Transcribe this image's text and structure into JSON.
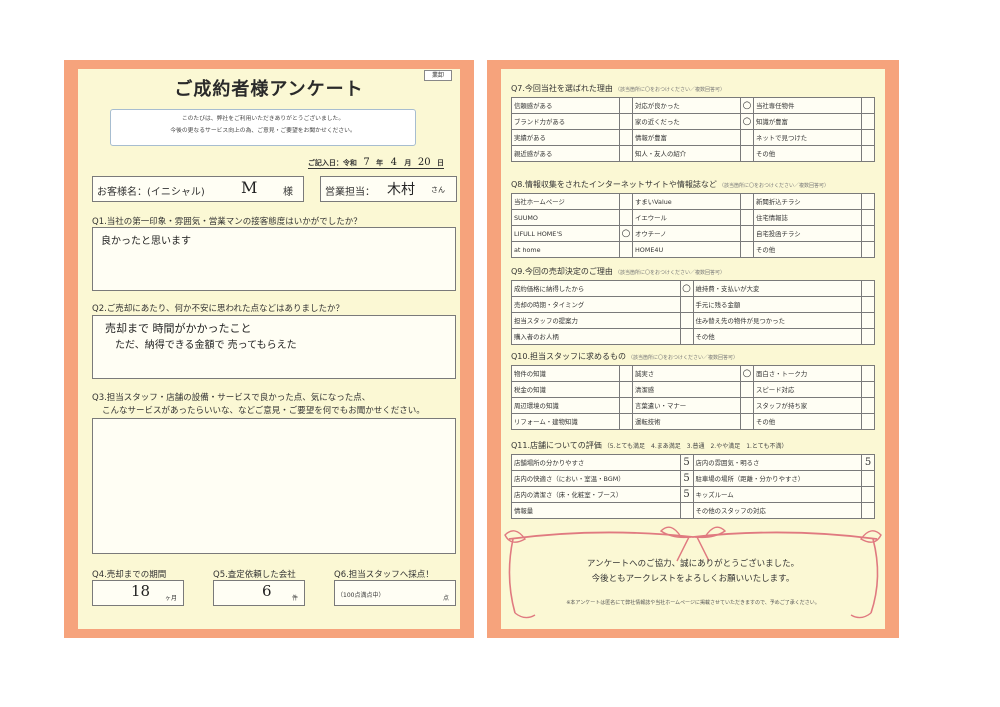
{
  "left": {
    "badge": "業卸",
    "title": "ご成約者様アンケート",
    "intro_line1": "このたびは、弊社をご利用いただきありがとうございました。",
    "intro_line2": "今後の更なるサービス向上の為、ご意見・ご要望をお聞かせください。",
    "date_label": "ご記入日：令和",
    "date_year": "7",
    "date_year_unit": "年",
    "date_month": "4",
    "date_month_unit": "月",
    "date_day": "20",
    "date_day_unit": "日",
    "customer_label": "お客様名：(イニシャル)",
    "customer_value": "M",
    "customer_suffix": "様",
    "staff_label": "営業担当：",
    "staff_value": "木村",
    "staff_suffix": "さん",
    "q1": "Q1.当社の第一印象・雰囲気・営業マンの接客態度はいかがでしたか？",
    "a1": "良かったと思います",
    "q2": "Q2.ご売却にあたり、何か不安に思われた点などはありましたか？",
    "a2_line1": "売却まで 時間がかかったこと",
    "a2_line2": "ただ、納得できる金額で 売ってもらえた",
    "q3_line1": "Q3.担当スタッフ・店舗の設備・サービスで良かった点、気になった点、",
    "q3_line2": "こんなサービスがあったらいいな、などご意見・ご要望を何でもお聞かせください。",
    "a3": "",
    "q4": "Q4.売却までの期間",
    "a4": "18",
    "a4_unit": "ヶ月",
    "q5": "Q5.査定依頼した会社",
    "a5": "6",
    "a5_unit": "件",
    "q6": "Q6.担当スタッフへ採点！",
    "a6_hint": "（100点満点中）",
    "a6_unit": "点"
  },
  "right": {
    "q7": {
      "title": "Q7.今回当社を選ばれた理由",
      "note": "（該当箇所に〇をおつけください／複数回答可）",
      "rows": [
        [
          {
            "label": "信頼感がある",
            "mark": ""
          },
          {
            "label": "対応が良かった",
            "mark": "○"
          },
          {
            "label": "当社専任物件",
            "mark": ""
          }
        ],
        [
          {
            "label": "ブランド力がある",
            "mark": ""
          },
          {
            "label": "家の近くだった",
            "mark": "○"
          },
          {
            "label": "知識が豊富",
            "mark": ""
          }
        ],
        [
          {
            "label": "実績がある",
            "mark": ""
          },
          {
            "label": "情報が豊富",
            "mark": ""
          },
          {
            "label": "ネットで見つけた",
            "mark": ""
          }
        ],
        [
          {
            "label": "親近感がある",
            "mark": ""
          },
          {
            "label": "知人・友人の紹介",
            "mark": ""
          },
          {
            "label": "その他",
            "mark": ""
          }
        ]
      ]
    },
    "q8": {
      "title": "Q8.情報収集をされたインターネットサイトや情報誌など",
      "note": "（該当箇所に〇をおつけください／複数回答可）",
      "rows": [
        [
          {
            "label": "当社ホームページ",
            "mark": ""
          },
          {
            "label": "すまいValue",
            "mark": ""
          },
          {
            "label": "新聞折込チラシ",
            "mark": ""
          }
        ],
        [
          {
            "label": "SUUMO",
            "mark": ""
          },
          {
            "label": "イエウール",
            "mark": ""
          },
          {
            "label": "住宅情報誌",
            "mark": ""
          }
        ],
        [
          {
            "label": "LIFULL HOME'S",
            "mark": "○"
          },
          {
            "label": "オウチーノ",
            "mark": ""
          },
          {
            "label": "自宅投函チラシ",
            "mark": ""
          }
        ],
        [
          {
            "label": "at home",
            "mark": ""
          },
          {
            "label": "HOME4U",
            "mark": ""
          },
          {
            "label": "その他",
            "mark": ""
          }
        ]
      ]
    },
    "q9": {
      "title": "Q9.今回の売却決定のご理由",
      "note": "（該当箇所に〇をおつけください／複数回答可）",
      "rows": [
        [
          {
            "label": "成約価格に納得したから",
            "mark": "○"
          },
          {
            "label": "維持費・支払いが大変",
            "mark": ""
          }
        ],
        [
          {
            "label": "売却の時期・タイミング",
            "mark": ""
          },
          {
            "label": "手元に残る金額",
            "mark": ""
          }
        ],
        [
          {
            "label": "担当スタッフの提案力",
            "mark": ""
          },
          {
            "label": "住み替え先の物件が見つかった",
            "mark": ""
          }
        ],
        [
          {
            "label": "購入者のお人柄",
            "mark": ""
          },
          {
            "label": "その他",
            "mark": ""
          }
        ]
      ]
    },
    "q10": {
      "title": "Q10.担当スタッフに求めるもの",
      "note": "（該当箇所に〇をおつけください／複数回答可）",
      "rows": [
        [
          {
            "label": "物件の知識",
            "mark": ""
          },
          {
            "label": "誠実さ",
            "mark": "○"
          },
          {
            "label": "面白さ・トーク力",
            "mark": ""
          }
        ],
        [
          {
            "label": "税金の知識",
            "mark": ""
          },
          {
            "label": "清潔感",
            "mark": ""
          },
          {
            "label": "スピード対応",
            "mark": ""
          }
        ],
        [
          {
            "label": "周辺環境の知識",
            "mark": ""
          },
          {
            "label": "言葉遣い・マナー",
            "mark": ""
          },
          {
            "label": "スタッフが持ち家",
            "mark": ""
          }
        ],
        [
          {
            "label": "リフォーム・建物知識",
            "mark": ""
          },
          {
            "label": "運転技術",
            "mark": ""
          },
          {
            "label": "その他",
            "mark": ""
          }
        ]
      ]
    },
    "q11": {
      "title": "Q11.店舗についての評価",
      "scale": "（5.とても満足　4.まあ満足　3.普通　2.やや満足　1.とても不満）",
      "rows": [
        [
          {
            "label": "店舗場所の分かりやすさ",
            "mark": "5"
          },
          {
            "label": "店内の雰囲気・明るさ",
            "mark": "5"
          }
        ],
        [
          {
            "label": "店内の快適さ（におい・室温・BGM）",
            "mark": "5"
          },
          {
            "label": "駐車場の場所（距離・分かりやすさ）",
            "mark": ""
          }
        ],
        [
          {
            "label": "店内の清潔さ（床・化粧室・ブース）",
            "mark": "5"
          },
          {
            "label": "キッズルーム",
            "mark": ""
          }
        ],
        [
          {
            "label": "情報量",
            "mark": ""
          },
          {
            "label": "その他のスタッフの対応",
            "mark": ""
          }
        ]
      ]
    },
    "thanks_line1": "アンケートへのご協力、誠にありがとうございました。",
    "thanks_line2": "今後ともアークレストをよろしくお願いいたします。",
    "footnote": "※本アンケートは匿名にて弊社情報誌や当社ホームページに掲載させていただきますので、予めご了承ください。"
  },
  "colors": {
    "frame": "#f6a37c",
    "paper": "#fbf8d4",
    "ribbon": "#e07a80",
    "line": "#7a7a7a"
  }
}
